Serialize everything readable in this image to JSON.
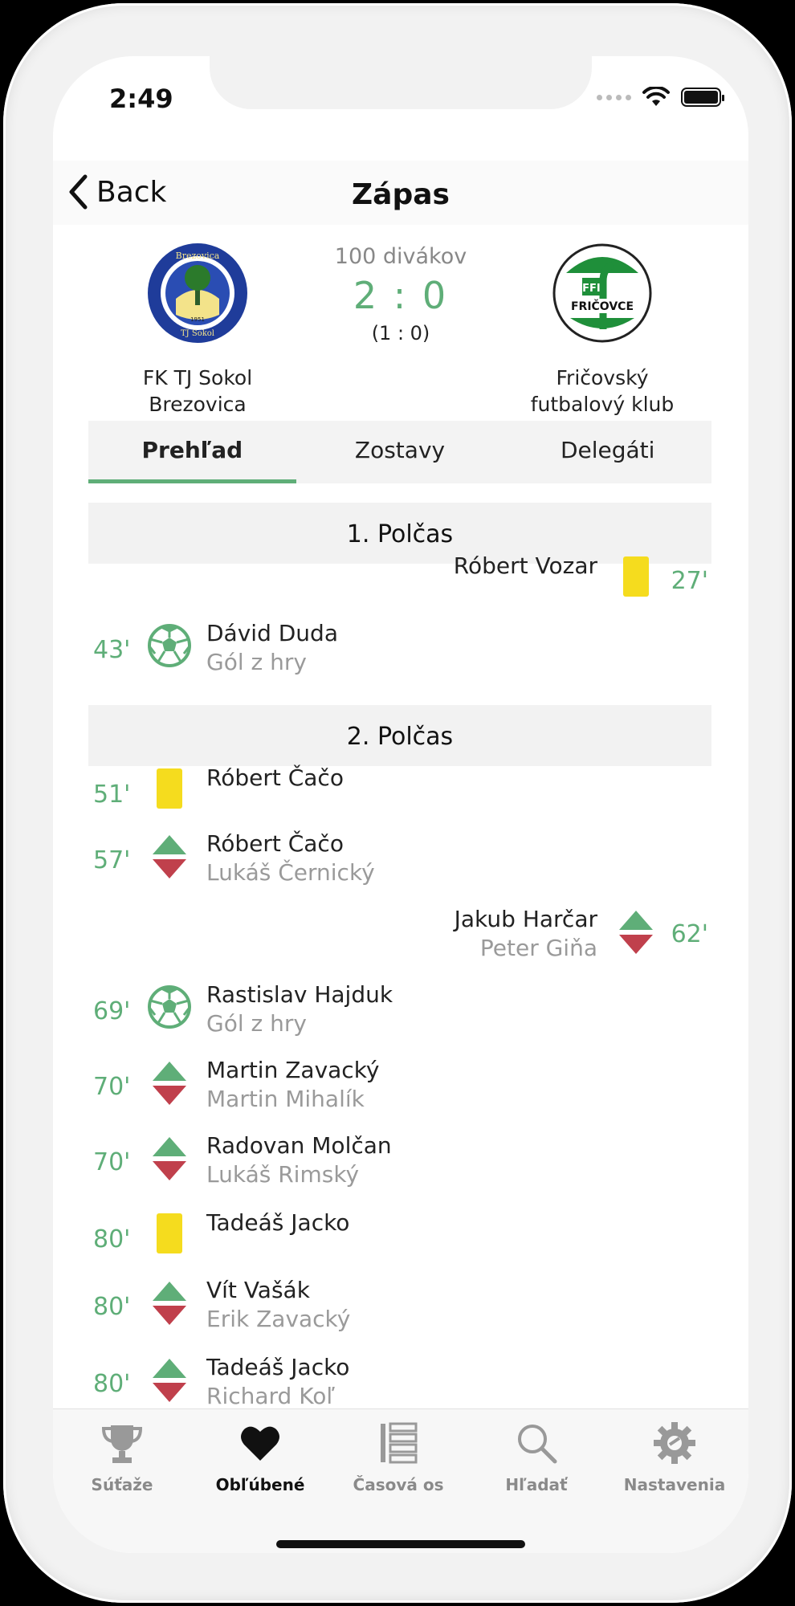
{
  "status": {
    "time": "2:49"
  },
  "nav": {
    "back_label": "Back",
    "title": "Zápas"
  },
  "match": {
    "spectators": "100 divákov",
    "score": "2 : 0",
    "halftime": "(1 : 0)",
    "home": {
      "name_line1": "FK TJ Sokol",
      "name_line2": "Brezovica",
      "logo_text_top": "Brezovica",
      "logo_text_bottom": "TJ Sokol",
      "logo_year": "1951"
    },
    "away": {
      "name_line1": "Fričovský",
      "name_line2": "futbalový klub",
      "logo_text": "FRIČOVCE",
      "logo_abbr": "FFK"
    }
  },
  "tabs": [
    "Prehľad",
    "Zostavy",
    "Delegáti"
  ],
  "halves": [
    "1. Polčas",
    "2. Polčas"
  ],
  "events": [
    {
      "minute": "27'",
      "side": "away",
      "type": "yellow-card",
      "main": "Róbert Vozar",
      "sub": ""
    },
    {
      "minute": "43'",
      "side": "home",
      "type": "goal",
      "main": "Dávid Duda",
      "sub": "Gól z hry"
    },
    {
      "minute": "51'",
      "side": "home",
      "type": "yellow-card",
      "main": "Róbert Čačo",
      "sub": ""
    },
    {
      "minute": "57'",
      "side": "home",
      "type": "substitution",
      "main": "Róbert Čačo",
      "sub": "Lukáš Černický"
    },
    {
      "minute": "62'",
      "side": "away",
      "type": "substitution",
      "main": "Jakub Harčar",
      "sub": "Peter Giňa"
    },
    {
      "minute": "69'",
      "side": "home",
      "type": "goal",
      "main": "Rastislav Hajduk",
      "sub": "Gól z hry"
    },
    {
      "minute": "70'",
      "side": "home",
      "type": "substitution",
      "main": "Martin Zavacký",
      "sub": "Martin Mihalík"
    },
    {
      "minute": "70'",
      "side": "home",
      "type": "substitution",
      "main": "Radovan Molčan",
      "sub": "Lukáš Rimský"
    },
    {
      "minute": "80'",
      "side": "home",
      "type": "yellow-card",
      "main": "Tadeáš Jacko",
      "sub": ""
    },
    {
      "minute": "80'",
      "side": "home",
      "type": "substitution",
      "main": "Vít Vašák",
      "sub": "Erik Zavacký"
    },
    {
      "minute": "80'",
      "side": "home",
      "type": "substitution",
      "main": "Tadeáš Jacko",
      "sub": "Richard Koľ"
    }
  ],
  "tabbar": [
    {
      "label": "Súťaže",
      "icon": "trophy-icon"
    },
    {
      "label": "Obľúbené",
      "icon": "heart-icon"
    },
    {
      "label": "Časová os",
      "icon": "timeline-icon"
    },
    {
      "label": "Hľadať",
      "icon": "search-icon"
    },
    {
      "label": "Nastavenia",
      "icon": "gear-icon"
    }
  ],
  "colors": {
    "accent": "#5fae78",
    "yellow_card": "#f5dc1e",
    "sub_in": "#5fae78",
    "sub_out": "#c0404c"
  }
}
